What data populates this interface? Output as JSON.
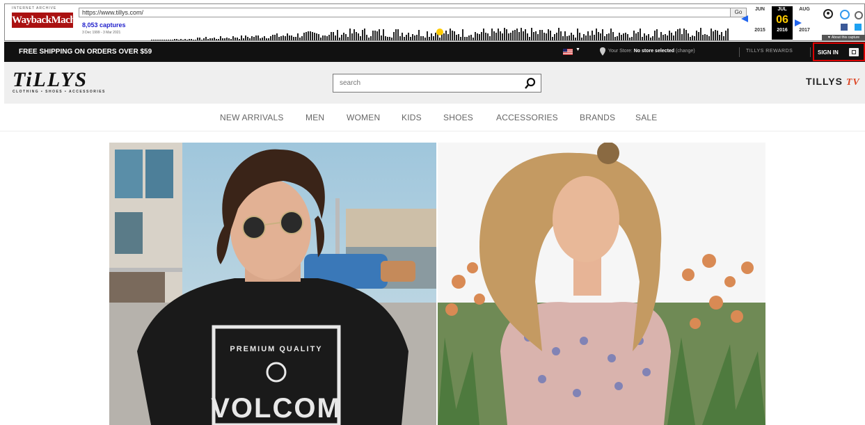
{
  "wayback": {
    "url": "https://www.tillys.com/",
    "go_label": "Go",
    "captures": "8,053 captures",
    "date_range": "3 Dec 1999 - 3 Mar 2021",
    "months": [
      "JUN",
      "JUL",
      "AUG"
    ],
    "day": "06",
    "years": [
      "2015",
      "2016",
      "2017"
    ],
    "about_label": "▼ About this capture",
    "logo_top": "INTERNET ARCHIVE",
    "logo": "WaybackMachine"
  },
  "topbar": {
    "shipping": "FREE SHIPPING ON ORDERS OVER $59",
    "store_label": "Your Store:",
    "store_value": "No store selected",
    "store_change": "(change)",
    "rewards": "TILLYS REWARDS",
    "signin": "SIGN IN"
  },
  "header": {
    "logo_word": "TiLLYS",
    "logo_tag": "CLOTHING • SHOES • ACCESSORIES",
    "search_placeholder": "search",
    "tv_text": "TILLYS",
    "tv_suffix": "TV"
  },
  "nav": {
    "items": [
      "NEW ARRIVALS",
      "MEN",
      "WOMEN",
      "KIDS",
      "SHOES",
      "ACCESSORIES",
      "BRANDS",
      "SALE"
    ]
  },
  "hero": {
    "left_shirt_top": "PREMIUM QUALITY",
    "left_shirt_brand": "VOLCOM"
  },
  "colors": {
    "topbar_bg": "#111111",
    "header_bg": "#efefef",
    "signin_border": "#dd0000",
    "tv_accent": "#dd4422"
  }
}
